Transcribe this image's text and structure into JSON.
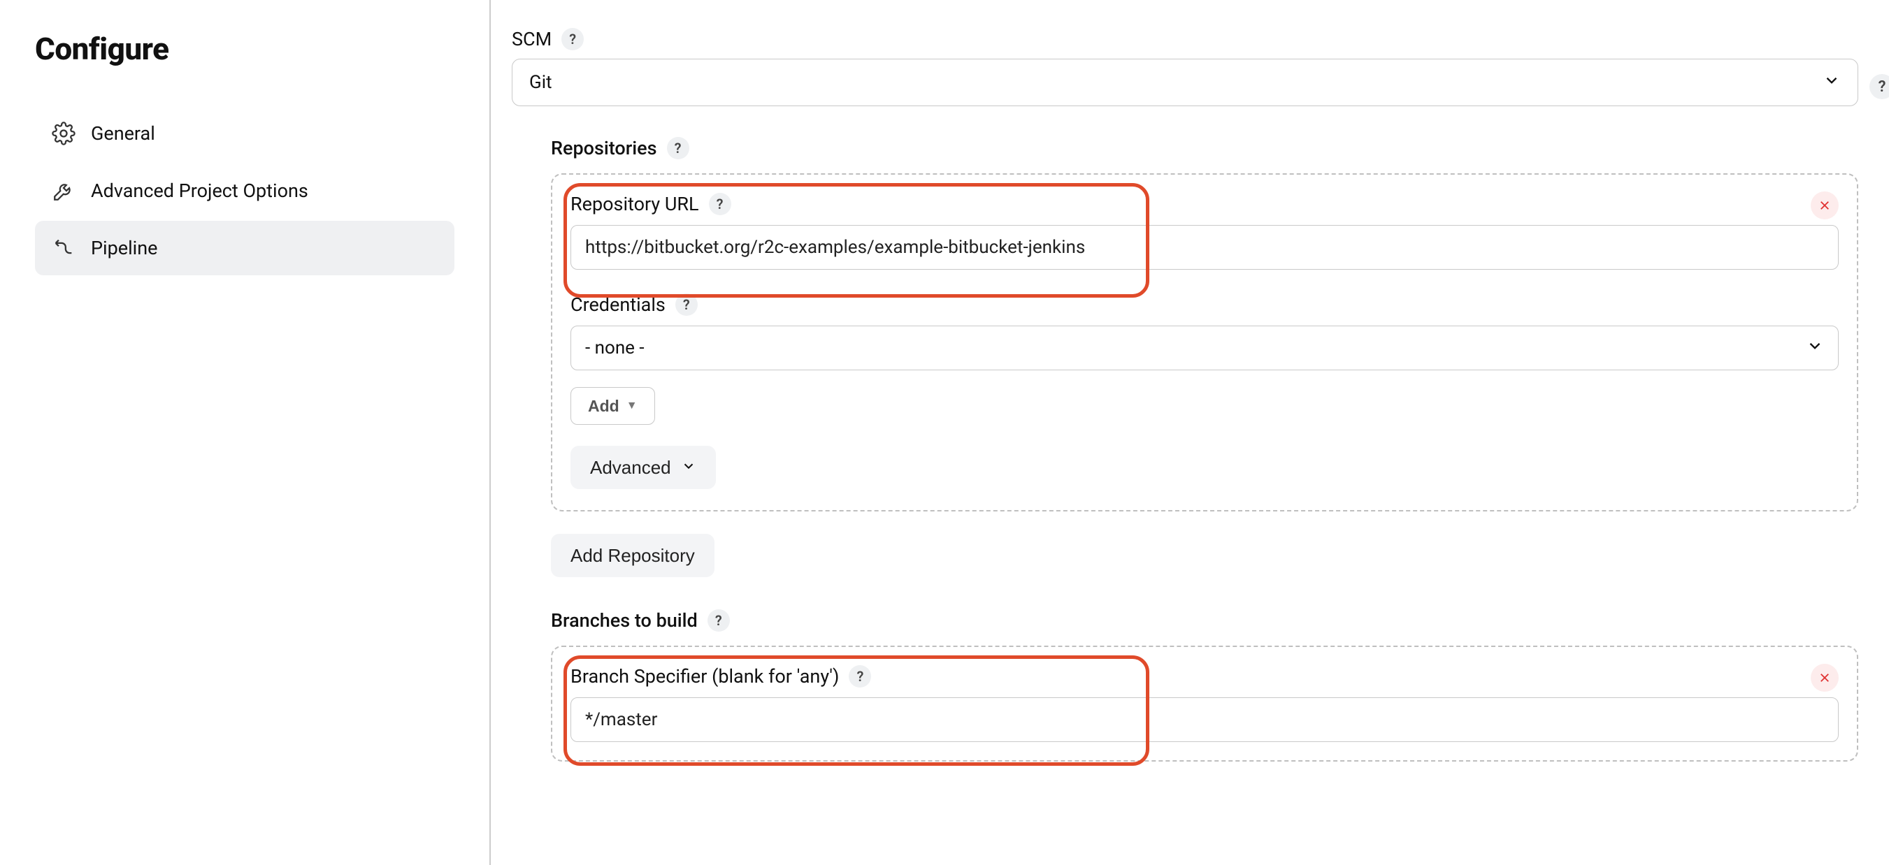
{
  "sidebar": {
    "title": "Configure",
    "items": [
      {
        "label": "General",
        "icon": "gear-icon",
        "active": false
      },
      {
        "label": "Advanced Project Options",
        "icon": "wrench-icon",
        "active": false
      },
      {
        "label": "Pipeline",
        "icon": "pipeline-icon",
        "active": true
      }
    ]
  },
  "scm": {
    "label": "SCM",
    "selected": "Git"
  },
  "repositories": {
    "section_label": "Repositories",
    "repo_url_label": "Repository URL",
    "repo_url_value": "https://bitbucket.org/r2c-examples/example-bitbucket-jenkins",
    "credentials_label": "Credentials",
    "credentials_selected": "- none -",
    "add_label": "Add",
    "advanced_label": "Advanced",
    "add_repository_label": "Add Repository"
  },
  "branches": {
    "section_label": "Branches to build",
    "specifier_label": "Branch Specifier (blank for 'any')",
    "specifier_value": "*/master"
  },
  "help_char": "?"
}
